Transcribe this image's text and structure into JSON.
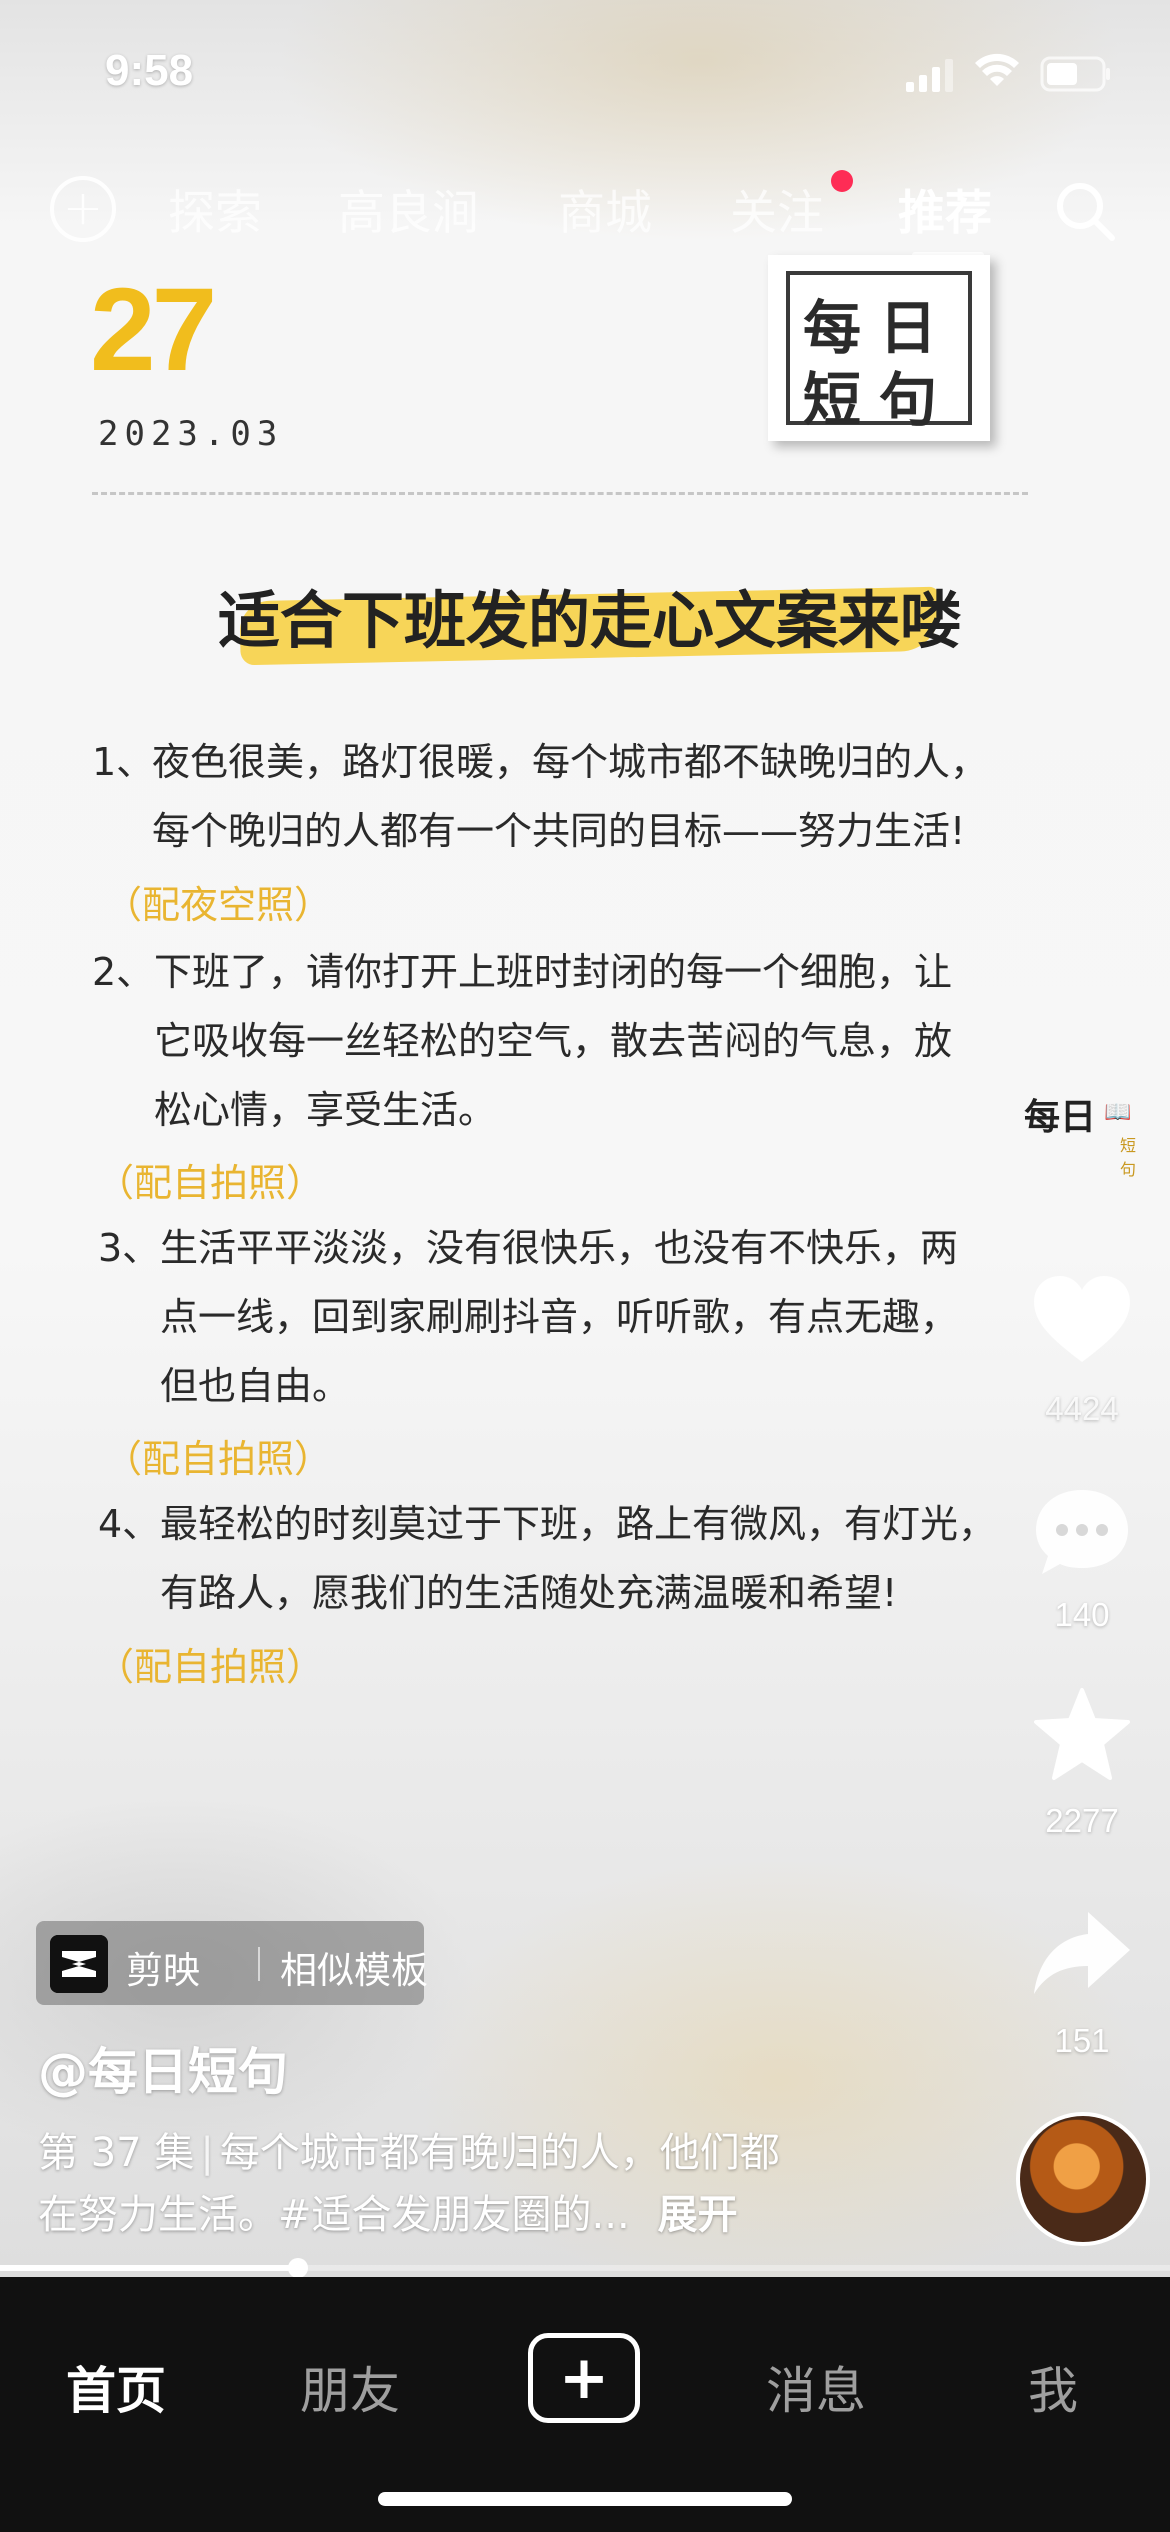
{
  "status_bar": {
    "time": "9:58"
  },
  "top_nav": {
    "tabs": [
      {
        "label": "探索"
      },
      {
        "label": "高良涧"
      },
      {
        "label": "商城"
      },
      {
        "label": "关注"
      },
      {
        "label": "推荐",
        "active": true
      }
    ],
    "notification_dot_color": "#fe2c55"
  },
  "card": {
    "day": "27",
    "month": "2023.03",
    "logo_line1": "每日",
    "logo_line2": "短句",
    "headline": "适合下班发的走心文案来喽",
    "highlight_color": "#f7d34f",
    "items": [
      {
        "num": "1、",
        "lines": [
          "夜色很美，路灯很暖，每个城市都不缺晚归的人，",
          "每个晚归的人都有一个共同的目标——努力生活!"
        ],
        "note": "（配夜空照）"
      },
      {
        "num": "2、",
        "lines": [
          "下班了，请你打开上班时封闭的每一个细胞，让",
          "它吸收每一丝轻松的空气，散去苦闷的气息，放",
          "松心情，享受生活。"
        ],
        "note": "（配自拍照）"
      },
      {
        "num": "3、",
        "lines": [
          "生活平平淡淡，没有很快乐，也没有不快乐，两",
          "点一线，回到家刷刷抖音，听听歌，有点无趣，",
          "但也自由。"
        ],
        "note": "（配自拍照）"
      },
      {
        "num": "4、",
        "lines": [
          "最轻松的时刻莫过于下班，路上有微风，有灯光，",
          "有路人，愿我们的生活随处充满温暖和希望!"
        ],
        "note": "（配自拍照）"
      }
    ]
  },
  "right_rail": {
    "brand_title": "每日",
    "brand_sub": "短句",
    "likes": "4424",
    "comments": "140",
    "favorites": "2277",
    "shares": "151"
  },
  "capcut": {
    "app": "剪映",
    "action": "相似模板"
  },
  "author": "@每日短句",
  "description": {
    "episode": "第 37 集",
    "line1": "每个城市都有晚归的人，他们都",
    "line2": "在努力生活。#适合发朋友圈的...",
    "expand": "展开"
  },
  "progress": {
    "fraction": 0.255
  },
  "bottom_tabs": {
    "home": "首页",
    "friends": "朋友",
    "messages": "消息",
    "me": "我"
  },
  "icons": [
    "add-circle-icon",
    "search-icon",
    "heart-icon",
    "comment-icon",
    "star-icon",
    "share-icon",
    "capcut-logo-icon",
    "plus-icon"
  ]
}
